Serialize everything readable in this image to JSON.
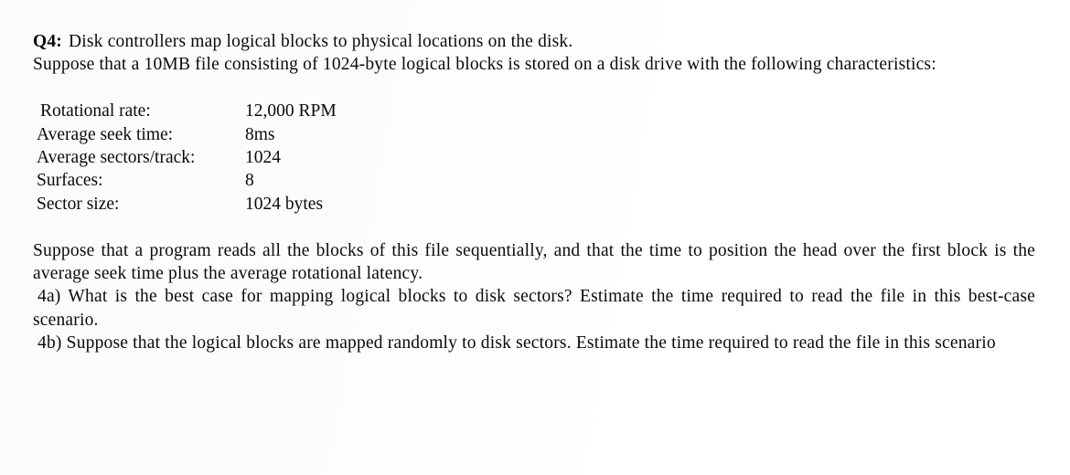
{
  "document": {
    "question_label": "Q4:",
    "intro_line": "Disk controllers map logical blocks to physical locations on the disk.",
    "intro_paragraph": "Suppose that a 10MB file consisting of 1024-byte logical blocks is stored on a disk drive with the following characteristics:",
    "specs": {
      "rows": [
        {
          "label": "Rotational rate:",
          "value": "12,000 RPM"
        },
        {
          "label": "Average seek time:",
          "value": "8ms"
        },
        {
          "label": "Average sectors/track:",
          "value": "1024"
        },
        {
          "label": "Surfaces:",
          "value": "8"
        },
        {
          "label": "Sector size:",
          "value": "1024 bytes"
        }
      ]
    },
    "body_paragraph": "Suppose that a program reads all the blocks of this file sequentially, and that the time to position the head over the first block is the average seek time plus the average rotational latency.",
    "parts": [
      {
        "id": "4a",
        "text": "4a) What is the best case for mapping logical blocks to disk sectors? Estimate the time required to read the file in this best-case scenario."
      },
      {
        "id": "4b",
        "text": "4b) Suppose that the logical blocks are mapped randomly to disk sectors. Estimate the time required to read the file in this scenario"
      }
    ]
  },
  "style": {
    "text_color": "#0b0b0b",
    "background_color": "#fdfdfd"
  }
}
